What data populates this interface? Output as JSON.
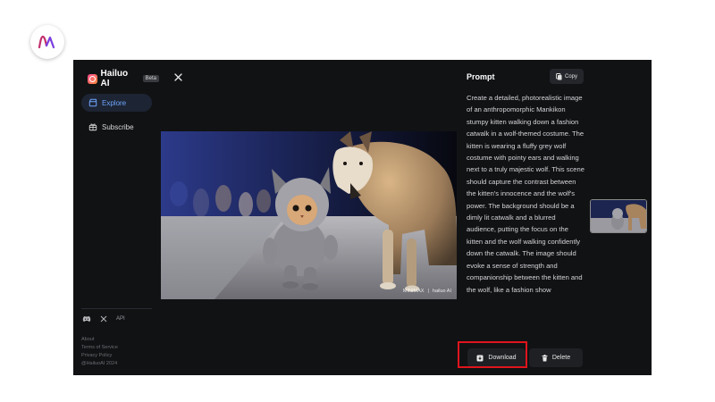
{
  "brand_mark": {
    "icon": "brand-logo-icon"
  },
  "sidebar": {
    "logo_text": "Hailuo AI",
    "beta_label": "Beta",
    "items": [
      {
        "label": "Explore",
        "icon": "clapperboard-icon",
        "active": true
      },
      {
        "label": "Subscribe",
        "icon": "gift-icon",
        "active": false
      }
    ],
    "social": {
      "api_label": "API"
    },
    "footer": {
      "about": "About",
      "terms": "Terms of Service",
      "privacy": "Privacy Policy",
      "copyright": "@HailuoAI 2024"
    }
  },
  "viewer": {
    "watermark_left": "MINIMAX",
    "watermark_right": "hailuo AI"
  },
  "prompt": {
    "title": "Prompt",
    "copy_label": "Copy",
    "text": "Create a detailed, photorealistic image of an anthropomorphic Mankikon stumpy kitten walking down a fashion catwalk in a wolf-themed costume. The kitten is wearing a fluffy grey wolf costume with pointy ears and walking next to a truly majestic wolf. This scene should capture the contrast between the kitten's innocence and the wolf's power. The background should be a dimly lit catwalk and a blurred audience, putting the focus on the kitten and the wolf walking confidently down the catwalk. The image should evoke a sense of strength and companionship between the kitten and the wolf, like a fashion show"
  },
  "actions": {
    "download_label": "Download",
    "delete_label": "Delete"
  },
  "colors": {
    "background": "#111214",
    "accent": "#6ea6ff",
    "highlight": "#e0141c"
  }
}
